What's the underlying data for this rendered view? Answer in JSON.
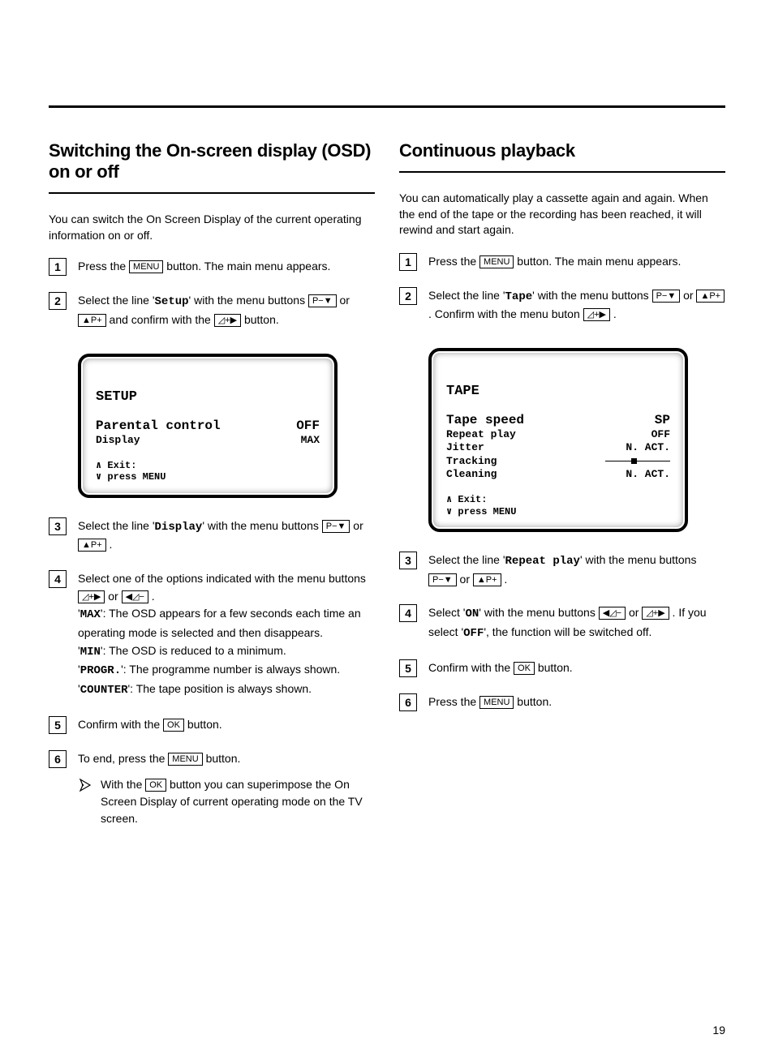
{
  "page_number": "19",
  "left": {
    "heading": "Switching the On-screen display (OSD) on or off",
    "intro": "You can switch the On Screen Display of the current operating information on or off.",
    "steps": {
      "s1": {
        "num": "1",
        "pre": "Press the ",
        "btn": "MENU",
        "post": " button. The main menu appears."
      },
      "s2": {
        "num": "2",
        "pre": "Select the line '",
        "mono": "Setup",
        "mid": "' with the menu buttons ",
        "b1": "P−▼",
        "or": " or ",
        "b2": "▲P+",
        "mid2": " and confirm with the ",
        "b3": "◿+▶",
        "post": " button."
      },
      "s3": {
        "num": "3",
        "pre": "Select the line '",
        "mono": "Display",
        "mid": "' with the menu buttons ",
        "b1": "P−▼",
        "or": " or ",
        "b2": "▲P+",
        "post": " ."
      },
      "s4": {
        "num": "4",
        "line1_pre": "Select one of the options indicated with the menu buttons ",
        "b1": "◿+▶",
        "or": " or ",
        "b2": "◀◿−",
        "post1": " .",
        "opt_max_k": "MAX",
        "opt_max_v": "': The OSD appears for a few seconds each time an operating mode is selected and then disappears.",
        "opt_min_k": "MIN",
        "opt_min_v": "': The OSD is reduced to a minimum.",
        "opt_progr_k": "PROGR.",
        "opt_progr_v": "': The programme number is always shown.",
        "opt_counter_k": "COUNTER",
        "opt_counter_v": "': The tape position is always shown."
      },
      "s5": {
        "num": "5",
        "pre": "Confirm with the ",
        "btn": "OK",
        "post": " button."
      },
      "s6": {
        "num": "6",
        "pre": "To end, press the ",
        "btn": "MENU",
        "post": " button."
      }
    },
    "tip": {
      "pre": "With the ",
      "btn": "OK",
      "post": " button you can superimpose the On Screen Display of current operating mode on the TV screen."
    },
    "osd": {
      "title": "SETUP",
      "rows": [
        {
          "k": "Parental control",
          "v": "OFF",
          "big": true
        },
        {
          "k": "Display",
          "v": "MAX"
        }
      ],
      "exit1": "∧ Exit:",
      "exit2": "∨ press MENU"
    }
  },
  "right": {
    "heading": "Continuous playback",
    "intro": "You can automatically play a cassette again and again. When the end of the tape or the recording has been reached, it will rewind and start again.",
    "steps": {
      "s1": {
        "num": "1",
        "pre": "Press the ",
        "btn": "MENU",
        "post": " button. The main menu appears."
      },
      "s2": {
        "num": "2",
        "pre": "Select the line '",
        "mono": "Tape",
        "mid": "' with the menu buttons ",
        "b1": "P−▼",
        "or": " or ",
        "b2": "▲P+",
        "mid2": " . Confirm with the menu buton ",
        "b3": "◿+▶",
        "post": " ."
      },
      "s3": {
        "num": "3",
        "pre": "Select the line '",
        "mono": "Repeat play",
        "mid": "' with the menu buttons ",
        "b1": "P−▼",
        "or": " or ",
        "b2": "▲P+",
        "post": " ."
      },
      "s4": {
        "num": "4",
        "pre": "Select '",
        "mono": "ON",
        "mid": "' with the menu buttons ",
        "b1": "◀◿−",
        "or": " or ",
        "b2": "◿+▶",
        "mid2": " . If you select '",
        "mono2": "OFF",
        "post": "', the function will be switched off."
      },
      "s5": {
        "num": "5",
        "pre": "Confirm with the ",
        "btn": "OK",
        "post": " button."
      },
      "s6": {
        "num": "6",
        "pre": "Press the ",
        "btn": "MENU",
        "post": " button."
      }
    },
    "osd": {
      "title": "TAPE",
      "rows": [
        {
          "k": "Tape speed",
          "v": "SP",
          "big": true
        },
        {
          "k": "Repeat play",
          "v": "OFF"
        },
        {
          "k": "Jitter",
          "v": "N. ACT."
        },
        {
          "k": "Tracking",
          "gauge": true
        },
        {
          "k": "Cleaning",
          "v": "N. ACT."
        }
      ],
      "exit1": "∧ Exit:",
      "exit2": "∨ press MENU"
    }
  }
}
